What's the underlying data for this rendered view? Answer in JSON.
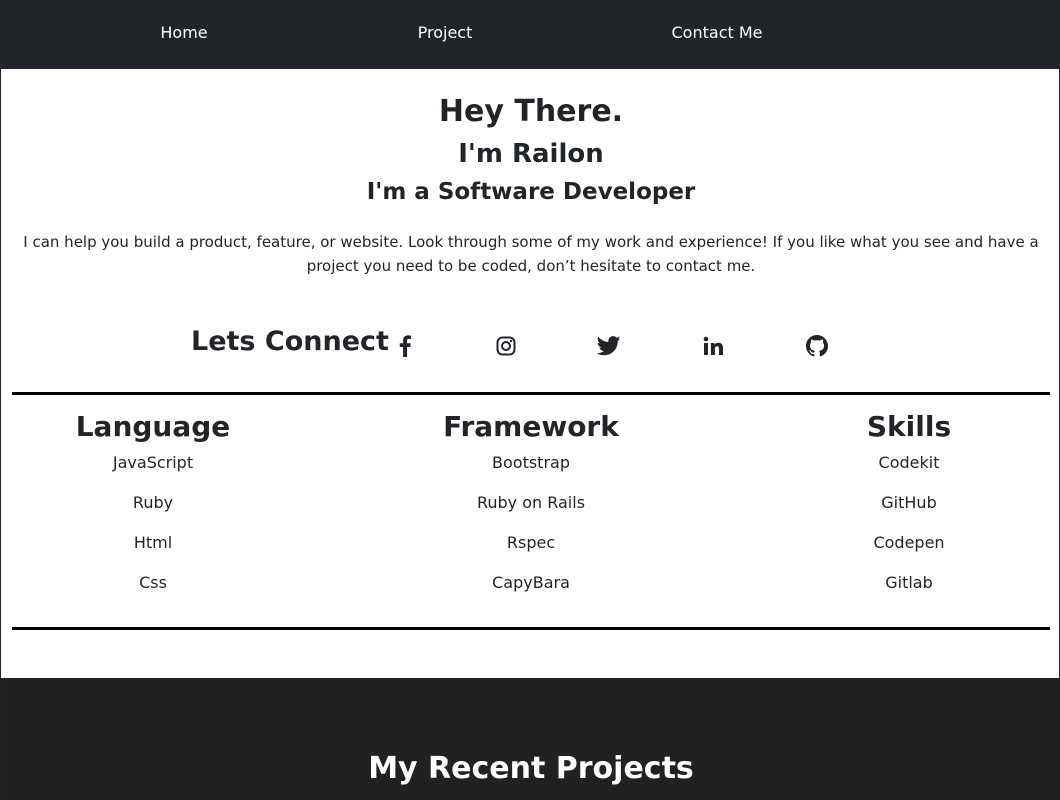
{
  "nav": {
    "items": [
      {
        "label": "Home"
      },
      {
        "label": "Project"
      },
      {
        "label": "Contact Me"
      }
    ]
  },
  "hero": {
    "greeting": "Hey There.",
    "name": "I'm Railon",
    "role": "I'm a Software Developer",
    "description": "I can help you build a product, feature, or website. Look through some of my work and experience! If you like what you see and have a project you need to be coded, don’t hesitate to contact me."
  },
  "connect": {
    "title": "Lets Connect",
    "icons": [
      "facebook-icon",
      "instagram-icon",
      "twitter-icon",
      "linkedin-icon",
      "github-icon"
    ]
  },
  "columns": [
    {
      "title": "Language",
      "items": [
        "JavaScript",
        "Ruby",
        "Html",
        "Css"
      ]
    },
    {
      "title": "Framework",
      "items": [
        "Bootstrap",
        "Ruby on Rails",
        "Rspec",
        "CapyBara"
      ]
    },
    {
      "title": "Skills",
      "items": [
        "Codekit",
        "GitHub",
        "Codepen",
        "Gitlab"
      ]
    }
  ],
  "projects": {
    "title": "My Recent Projects"
  },
  "colors": {
    "nav_bg": "#212529",
    "projects_bg": "#212121",
    "text": "#212529",
    "divider": "#000000"
  }
}
